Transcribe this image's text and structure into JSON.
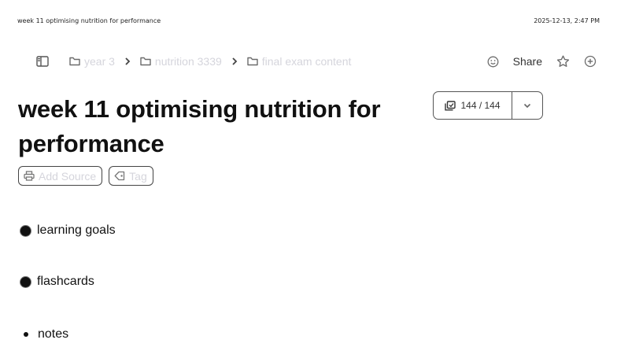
{
  "print_header": {
    "doc_title": "week 11 optimising nutrition for performance",
    "datetime": "2025-12-13, 2:47 PM"
  },
  "breadcrumbs": [
    {
      "label": "year 3",
      "icon": "folder-icon"
    },
    {
      "label": "nutrition 3339",
      "icon": "folder-icon"
    },
    {
      "label": "final exam content",
      "icon": "folder-icon"
    }
  ],
  "toolbar": {
    "share_label": "Share"
  },
  "page": {
    "title": "week 11 optimising nutrition for performance",
    "counter": "144 / 144"
  },
  "chips": {
    "add_source": "Add Source",
    "tag": "Tag"
  },
  "blocks": [
    {
      "label": "learning goals"
    },
    {
      "label": "flashcards"
    },
    {
      "label": "notes"
    }
  ]
}
